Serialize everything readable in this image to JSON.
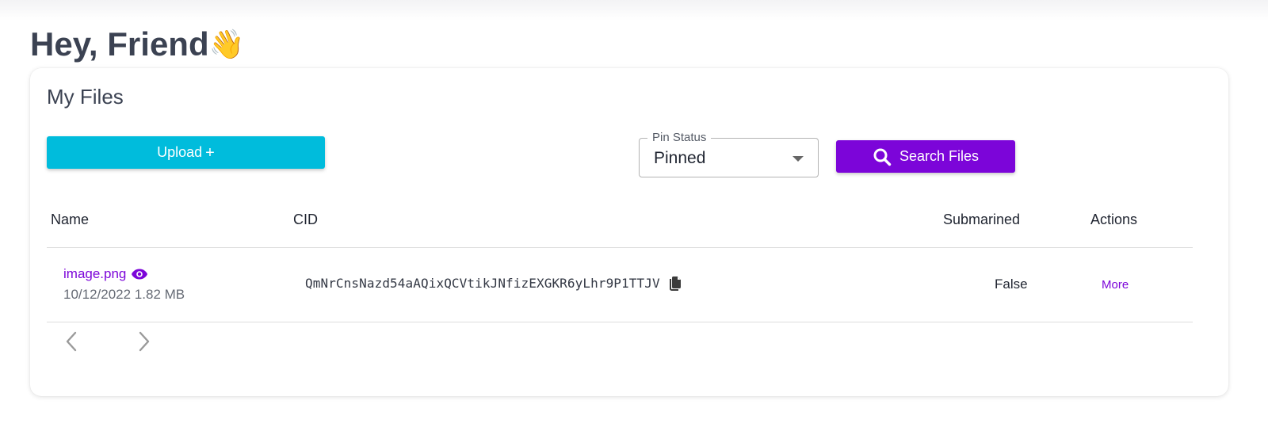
{
  "header": {
    "greeting": "Hey, Friend",
    "greeting_icon": "waving-hand-icon"
  },
  "files_card": {
    "title": "My Files",
    "upload_button": {
      "label": "Upload",
      "icon": "plus-icon",
      "color": "#00bcdc"
    },
    "pin_status": {
      "label": "Pin Status",
      "selected": "Pinned"
    },
    "search_button": {
      "label": "Search Files",
      "icon": "search-icon",
      "color": "#7c05d9"
    },
    "table": {
      "columns": [
        "Name",
        "CID",
        "Submarined",
        "Actions"
      ],
      "rows": [
        {
          "name": "image.png",
          "name_icon": "eye-icon",
          "meta": "10/12/2022 1.82 MB",
          "cid": "QmNrCnsNazd54aAQixQCVtikJNfizEXGKR6yLhr9P1TTJV",
          "cid_icon": "copy-icon",
          "submarined": "False",
          "action": "More"
        }
      ]
    },
    "pagination": {
      "prev_icon": "chevron-left-icon",
      "next_icon": "chevron-right-icon"
    }
  },
  "colors": {
    "accent": "#7c05d9",
    "upload": "#00bcdc",
    "heading": "#3b4252"
  }
}
